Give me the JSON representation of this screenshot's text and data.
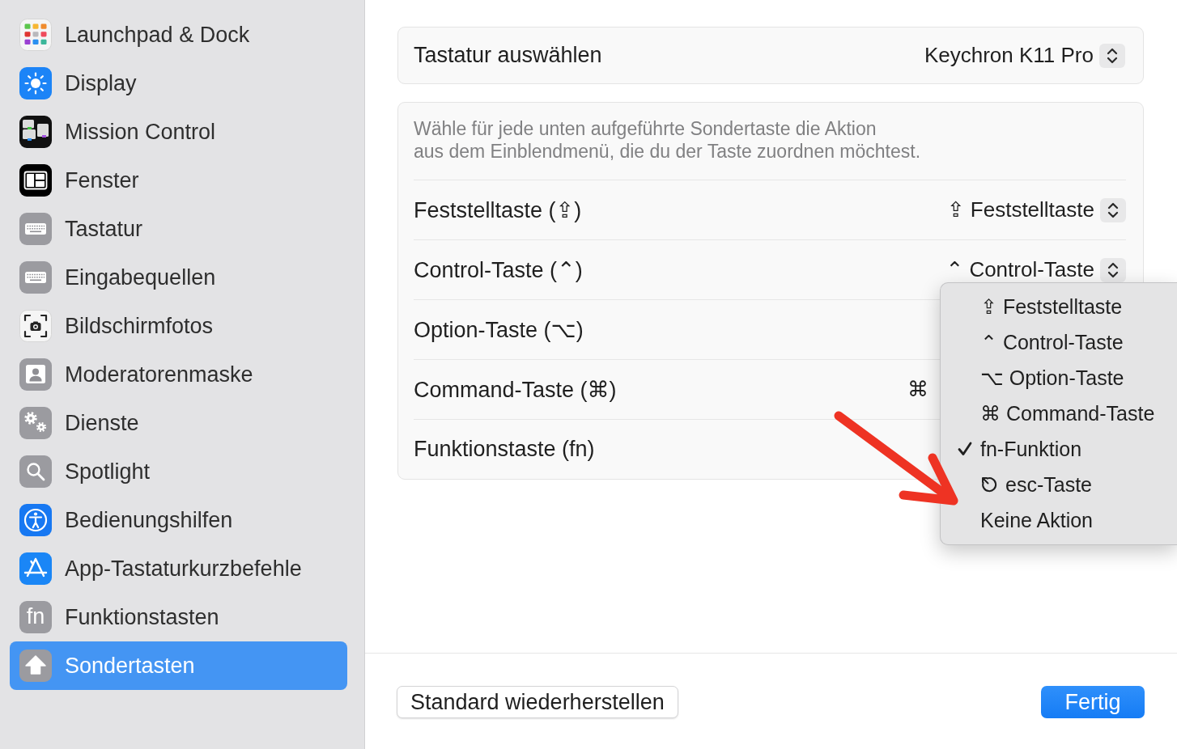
{
  "sidebar": {
    "items": [
      {
        "label": "Launchpad & Dock",
        "selected": false
      },
      {
        "label": "Display",
        "selected": false
      },
      {
        "label": "Mission Control",
        "selected": false
      },
      {
        "label": "Fenster",
        "selected": false
      },
      {
        "label": "Tastatur",
        "selected": false
      },
      {
        "label": "Eingabequellen",
        "selected": false
      },
      {
        "label": "Bildschirmfotos",
        "selected": false
      },
      {
        "label": "Moderatorenmaske",
        "selected": false
      },
      {
        "label": "Dienste",
        "selected": false
      },
      {
        "label": "Spotlight",
        "selected": false
      },
      {
        "label": "Bedienungshilfen",
        "selected": false
      },
      {
        "label": "App-Tastaturkurzbefehle",
        "selected": false
      },
      {
        "label": "Funktionstasten",
        "selected": false,
        "icon_text": "fn"
      },
      {
        "label": "Sondertasten",
        "selected": true
      }
    ]
  },
  "keyboard_picker": {
    "label": "Tastatur auswählen",
    "value": "Keychron K11 Pro"
  },
  "modifier_card": {
    "description": "Wähle für jede unten aufgeführte Sondertaste die Aktion\naus dem Einblendmenü, die du der Taste zuordnen möchtest.",
    "rows": [
      {
        "label": "Feststelltaste (⇪)",
        "value": {
          "text": "⇪ Feststelltaste",
          "covered": false
        }
      },
      {
        "label": "Control-Taste (⌃)",
        "value": {
          "text": "⌃ Control-Taste",
          "covered": false
        }
      },
      {
        "label": "Option-Taste (⌥)"
      },
      {
        "label": "Command-Taste (⌘)",
        "value": {
          "text": "⌘",
          "covered": true
        }
      },
      {
        "label": "Funktionstaste (fn)"
      }
    ]
  },
  "popup_menu": {
    "items": [
      {
        "kind": "text",
        "label": "⇪ Feststelltaste",
        "selected": false
      },
      {
        "kind": "text",
        "label": "⌃ Control-Taste",
        "selected": false
      },
      {
        "kind": "text",
        "label": "⌥ Option-Taste",
        "selected": false
      },
      {
        "kind": "text",
        "label": "⌘ Command-Taste",
        "selected": false
      },
      {
        "kind": "text",
        "label": "fn-Funktion",
        "selected": true
      },
      {
        "kind": "icon",
        "label": "esc-Taste",
        "selected": false
      },
      {
        "kind": "text",
        "label": "Keine Aktion",
        "selected": false
      }
    ]
  },
  "annotation": {
    "kind": "arrow"
  },
  "footer": {
    "buttons": [
      {
        "label": "Standard wiederherstellen",
        "kind": "secondary"
      },
      {
        "label": "Fertig",
        "kind": "primary"
      }
    ]
  }
}
